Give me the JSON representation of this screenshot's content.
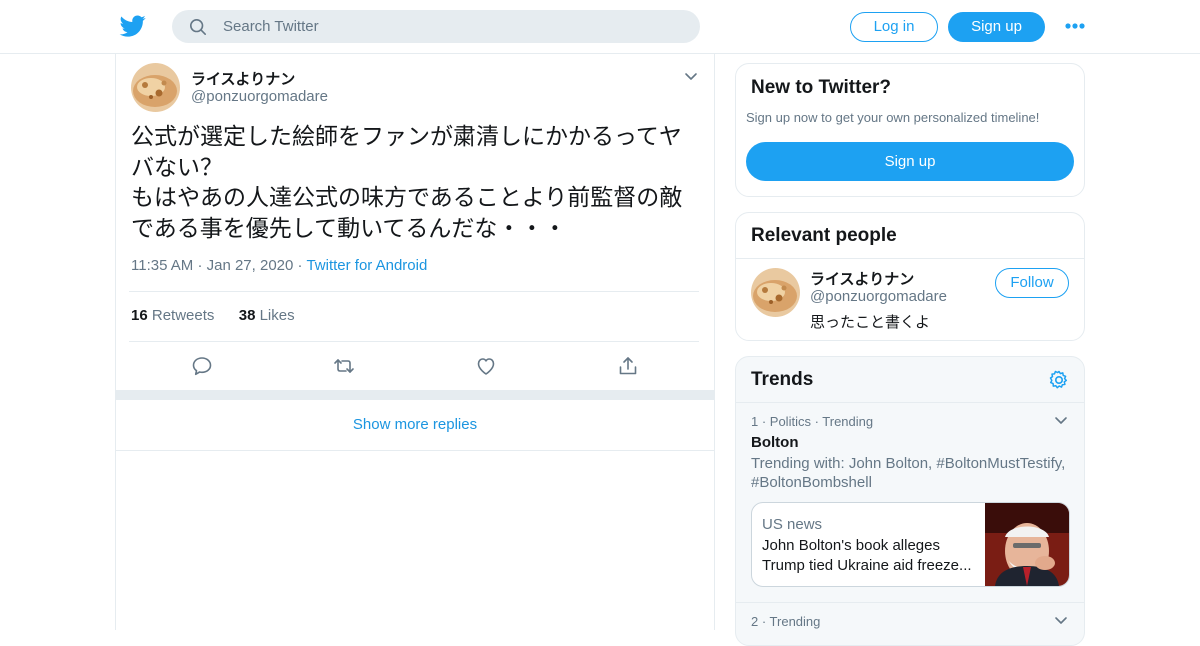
{
  "header": {
    "search_placeholder": "Search Twitter",
    "login_label": "Log in",
    "signup_label": "Sign up"
  },
  "tweet": {
    "author_name": "ライスよりナン",
    "author_handle": "@ponzuorgomadare",
    "text_line1": "公式が選定した絵師をファンが粛清しにかかるってヤ",
    "text_line2": "バない？",
    "text_line3": "もはやあの人達公式の味方であることより前監督の敵",
    "text_line4": "である事を優先して動いてるんだな・・・",
    "time": "11:35 AM",
    "date": "Jan 27, 2020",
    "source": "Twitter for Android",
    "retweets_count": "16",
    "retweets_label": "Retweets",
    "likes_count": "38",
    "likes_label": "Likes",
    "show_more_replies": "Show more replies"
  },
  "sidebar": {
    "new_to_twitter": {
      "title": "New to Twitter?",
      "subtitle": "Sign up now to get your own personalized timeline!",
      "signup_label": "Sign up"
    },
    "relevant_people": {
      "title": "Relevant people",
      "name": "ライスよりナン",
      "handle": "@ponzuorgomadare",
      "bio": "思ったこと書くよ",
      "follow_label": "Follow"
    },
    "trends": {
      "title": "Trends",
      "items": [
        {
          "meta": "1 · Politics · Trending",
          "name": "Bolton",
          "with_line1": "Trending with: John Bolton, #BoltonMustTestify,",
          "with_line2": "#BoltonBombshell",
          "news_category": "US news",
          "news_line1": "John Bolton's book alleges",
          "news_line2": "Trump tied Ukraine aid freeze..."
        },
        {
          "meta": "2 · Trending"
        }
      ]
    }
  },
  "colors": {
    "accent": "#1da1f2",
    "link": "#1b95e0",
    "muted": "#657786",
    "border": "#e6ecf0"
  }
}
